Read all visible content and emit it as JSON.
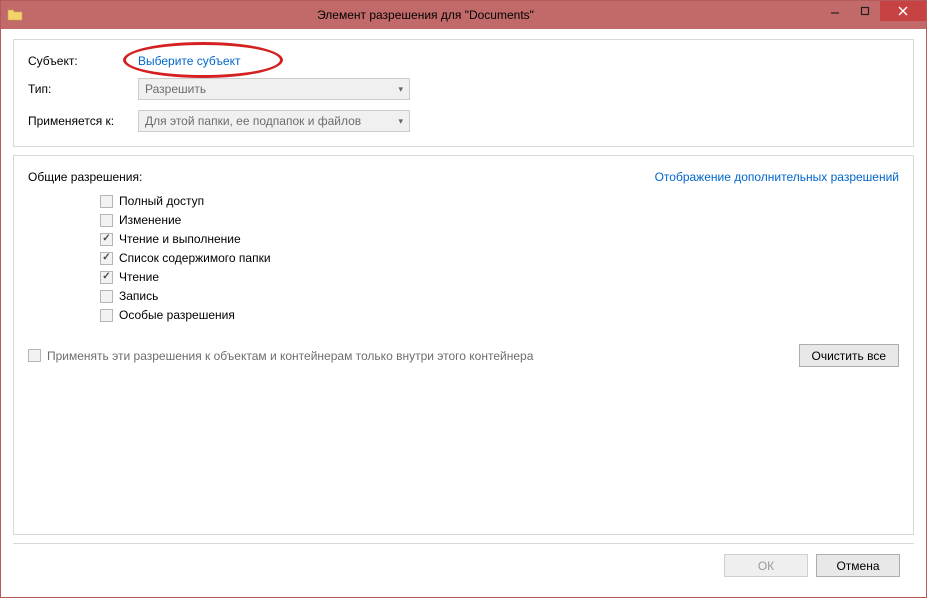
{
  "window": {
    "title": "Элемент разрешения для \"Documents\""
  },
  "top": {
    "subject_label": "Субъект:",
    "subject_link": "Выберите субъект",
    "type_label": "Тип:",
    "type_value": "Разрешить",
    "applies_label": "Применяется к:",
    "applies_value": "Для этой папки, ее подпапок и файлов"
  },
  "permissions": {
    "section_title": "Общие разрешения:",
    "advanced_link": "Отображение дополнительных разрешений",
    "items": [
      {
        "label": "Полный доступ",
        "checked": false
      },
      {
        "label": "Изменение",
        "checked": false
      },
      {
        "label": "Чтение и выполнение",
        "checked": true
      },
      {
        "label": "Список содержимого папки",
        "checked": true
      },
      {
        "label": "Чтение",
        "checked": true
      },
      {
        "label": "Запись",
        "checked": false
      },
      {
        "label": "Особые разрешения",
        "checked": false
      }
    ],
    "inherit_label": "Применять эти разрешения к объектам и контейнерам только внутри этого контейнера",
    "clear_button": "Очистить все"
  },
  "footer": {
    "ok": "ОК",
    "cancel": "Отмена"
  }
}
